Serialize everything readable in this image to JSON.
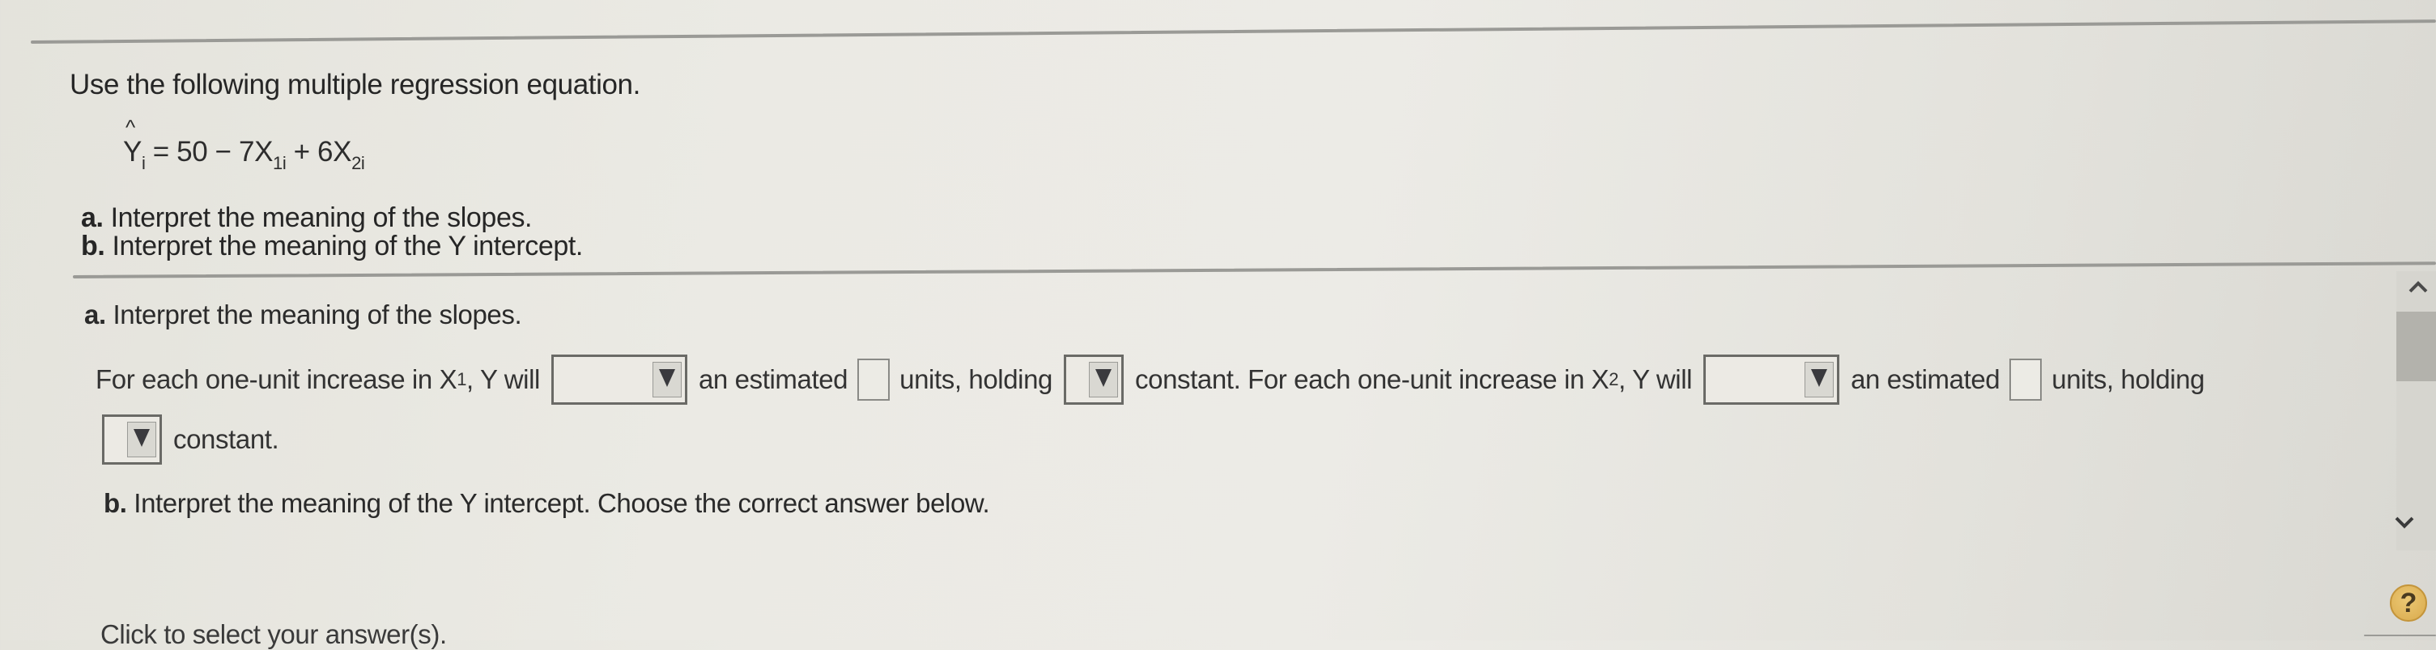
{
  "question": {
    "instruction": "Use the following multiple regression equation.",
    "equation": {
      "lhs": "Y",
      "lhs_subscript": "i",
      "equals": "=",
      "intercept": "50",
      "op1": "−",
      "coef1": "7X",
      "sub1": "1i",
      "op2": "+",
      "coef2": "6X",
      "sub2": "2i"
    },
    "task_a": {
      "prefix": "a.",
      "text": " Interpret the meaning of the slopes."
    },
    "task_b": {
      "prefix": "b.",
      "text": " Interpret the meaning of the Y intercept."
    }
  },
  "part_a": {
    "heading_prefix": "a.",
    "heading_text": " Interpret the meaning of the slopes.",
    "sentence": {
      "s1_pre": "For each one-unit increase in X",
      "s1_sub": "1",
      "s1_post": ", Y will",
      "dropdown1_value": "",
      "an_estimated_1": "an estimated",
      "input1_value": "",
      "units_holding_1": "units, holding",
      "dropdown2_value": "",
      "s2_pre": "constant. For each one-unit increase in X",
      "s2_sub": "2",
      "s2_post": ", Y will",
      "dropdown3_value": "",
      "an_estimated_2": "an estimated",
      "input2_value": "",
      "units_holding_2": "units, holding",
      "dropdown4_value": "",
      "constant_end": "constant."
    }
  },
  "part_b": {
    "heading_prefix": "b.",
    "heading_text": " Interpret the meaning of the Y intercept. Choose the correct answer below."
  },
  "footer": {
    "hint": "Click to select your answer(s)."
  },
  "controls": {
    "help_label": "?",
    "scroll_up_icon": "chevron-up",
    "scroll_down_icon": "chevron-down"
  }
}
